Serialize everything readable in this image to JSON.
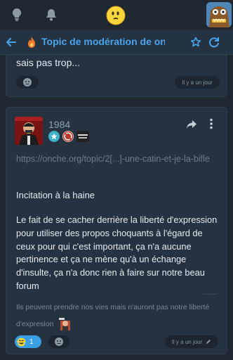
{
  "colors": {
    "accent": "#4aa4ee",
    "background": "#1f2731",
    "card": "#263240",
    "muted": "#8594a3"
  },
  "appbar": {
    "icons": [
      "lightbulb-icon",
      "bell-icon",
      "smiley-icon",
      "profile-avatar"
    ]
  },
  "topic": {
    "title": "Topic de modération de onche",
    "icons": [
      "back-arrow-icon",
      "fire-icon",
      "star-icon",
      "refresh-icon"
    ]
  },
  "previous_post": {
    "text": "sais pas trop...",
    "time": "Il y a un jour"
  },
  "post": {
    "author": "1984",
    "badges": [
      "star-badge",
      "no-badge",
      "sticker-badge"
    ],
    "link": "https://onche.org/topic/2[...]-une-catin-et-je-la-bifle",
    "heading": "Incitation à la haine",
    "body": "Le fait de se cacher derrière la liberté d'expression pour utiliser des propos choquants à l'égard de ceux pour qui c'est important, ça n'a aucune pertinence et ça ne mène qu'à un échange d'insulte, ça n'a donc rien à faire sur notre beau forum",
    "signature": "Ils peuvent prendre nos vies mais n'auront pas notre liberté d'expresion",
    "reactions": {
      "laugh_count": "1"
    },
    "time": "Il y a un jour"
  }
}
